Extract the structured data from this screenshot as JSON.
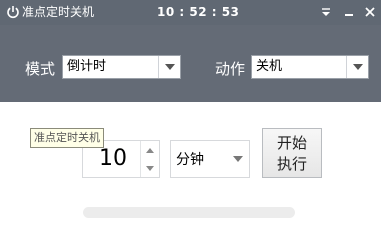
{
  "titlebar": {
    "title": "准点定时关机",
    "clock": "10 : 52 : 53",
    "power_icon": "power-icon",
    "dropdown_icon": "menu-dropdown-icon",
    "minimize_icon": "minimize-icon",
    "close_icon": "close-icon"
  },
  "header": {
    "mode_label": "模式",
    "mode_value": "倒计时",
    "action_label": "动作",
    "action_value": "关机"
  },
  "main": {
    "tooltip": "准点定时关机",
    "number_value": "10",
    "unit_value": "分钟",
    "start_label_line1": "开始",
    "start_label_line2": "执行",
    "progress": 0
  },
  "colors": {
    "header_bg": "#646b76",
    "titlebar_bg": "#606873"
  }
}
